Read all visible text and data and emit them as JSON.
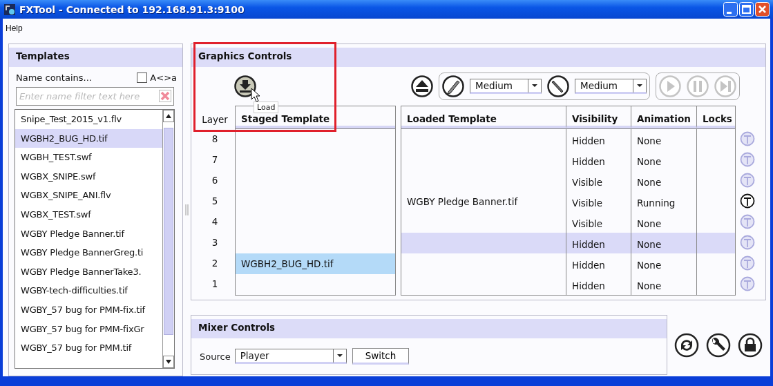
{
  "window": {
    "title": "FXTool - Connected to 192.168.91.3:9100"
  },
  "menu": [
    "Help"
  ],
  "templates": {
    "title": "Templates",
    "filter_label": "Name contains...",
    "case_checkbox": {
      "label": "A<>a",
      "checked": false
    },
    "filter": {
      "placeholder": "Enter name filter text here"
    },
    "items": [
      {
        "label": "Snipe_Test_2015_v1.flv",
        "selected": false
      },
      {
        "label": "WGBH2_BUG_HD.tif",
        "selected": true
      },
      {
        "label": "WGBH_TEST.swf",
        "selected": false
      },
      {
        "label": "WGBX_SNIPE.swf",
        "selected": false
      },
      {
        "label": "WGBX_SNIPE_ANI.flv",
        "selected": false
      },
      {
        "label": "WGBX_TEST.swf",
        "selected": false
      },
      {
        "label": "WGBY Pledge Banner.tif",
        "selected": false
      },
      {
        "label": "WGBY Pledge BannerGreg.ti",
        "selected": false
      },
      {
        "label": "WGBY Pledge BannerTake3.",
        "selected": false
      },
      {
        "label": "WGBY-tech-difficulties.tif",
        "selected": false
      },
      {
        "label": "WGBY_57 bug for PMM-fix.tif",
        "selected": false
      },
      {
        "label": "WGBY_57 bug for PMM-fixGr",
        "selected": false
      },
      {
        "label": "WGBY_57 bug for PMM.tif",
        "selected": false
      }
    ]
  },
  "graphics": {
    "title": "Graphics Controls",
    "load_tooltip": "Load",
    "dropdowns": [
      {
        "kind": "pencil",
        "value": "Medium"
      },
      {
        "kind": "knife",
        "value": "Medium"
      }
    ],
    "transport": [
      {
        "kind": "play",
        "disabled": true
      },
      {
        "kind": "pause",
        "disabled": true
      },
      {
        "kind": "next",
        "disabled": true
      }
    ],
    "staged_columns": [
      "Layer",
      "Staged Template"
    ],
    "loaded_columns": [
      "Loaded Template",
      "Visibility",
      "Animation",
      "Locks"
    ],
    "rows": [
      {
        "layer": "8",
        "staged": "",
        "staged_selected": false,
        "loaded": "",
        "visibility": "Hidden",
        "animation": "None",
        "selected": false,
        "lock_active": false
      },
      {
        "layer": "7",
        "staged": "",
        "staged_selected": false,
        "loaded": "",
        "visibility": "Hidden",
        "animation": "None",
        "selected": false,
        "lock_active": false
      },
      {
        "layer": "6",
        "staged": "",
        "staged_selected": false,
        "loaded": "",
        "visibility": "Visible",
        "animation": "None",
        "selected": false,
        "lock_active": false
      },
      {
        "layer": "5",
        "staged": "",
        "staged_selected": false,
        "loaded": "WGBY Pledge Banner.tif",
        "visibility": "Visible",
        "animation": "Running",
        "selected": false,
        "lock_active": true
      },
      {
        "layer": "4",
        "staged": "",
        "staged_selected": false,
        "loaded": "",
        "visibility": "Visible",
        "animation": "None",
        "selected": false,
        "lock_active": false
      },
      {
        "layer": "3",
        "staged": "",
        "staged_selected": false,
        "loaded": "",
        "visibility": "Hidden",
        "animation": "None",
        "selected": true,
        "lock_active": false
      },
      {
        "layer": "2",
        "staged": "WGBH2_BUG_HD.tif",
        "staged_selected": true,
        "loaded": "",
        "visibility": "Hidden",
        "animation": "None",
        "selected": false,
        "lock_active": false
      },
      {
        "layer": "1",
        "staged": "",
        "staged_selected": false,
        "loaded": "",
        "visibility": "Hidden",
        "animation": "None",
        "selected": false,
        "lock_active": false
      }
    ]
  },
  "mixer": {
    "title": "Mixer Controls",
    "source_label": "Source",
    "source": "Player",
    "button": "Switch"
  }
}
